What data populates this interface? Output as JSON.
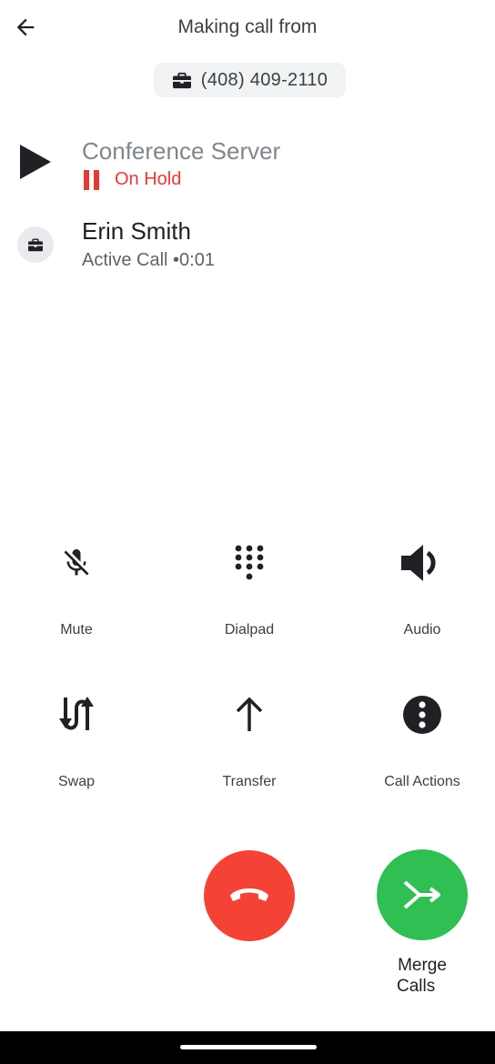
{
  "header": {
    "title": "Making call from",
    "caller_number": "(408) 409-2110"
  },
  "calls": [
    {
      "name": "Conference Server",
      "status": "On Hold",
      "icon": "play-icon"
    },
    {
      "name": "Erin Smith",
      "status": "Active Call •0:01",
      "icon": "briefcase-icon"
    }
  ],
  "actions": {
    "mute": "Mute",
    "dialpad": "Dialpad",
    "audio": "Audio",
    "swap": "Swap",
    "transfer": "Transfer",
    "call_actions": "Call Actions"
  },
  "merge": {
    "line1": "Merge",
    "line2": "Calls"
  },
  "colors": {
    "hold_red": "#e53935",
    "end_call_red": "#f44336",
    "merge_green": "#2fbf53"
  }
}
